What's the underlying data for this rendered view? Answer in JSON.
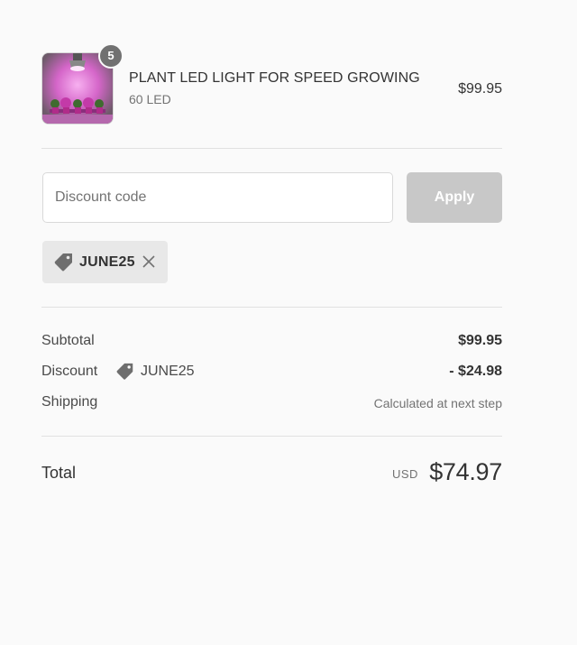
{
  "product": {
    "name": "PLANT LED LIGHT FOR SPEED GROWING",
    "variant": "60 LED",
    "price": "$99.95",
    "quantity": "5"
  },
  "discount_form": {
    "placeholder": "Discount code",
    "apply_label": "Apply"
  },
  "applied_discount": {
    "code": "JUNE25"
  },
  "summary": {
    "subtotal_label": "Subtotal",
    "subtotal_value": "$99.95",
    "discount_label": "Discount",
    "discount_code": "JUNE25",
    "discount_value": "- $24.98",
    "shipping_label": "Shipping",
    "shipping_value": "Calculated at next step"
  },
  "total": {
    "label": "Total",
    "currency": "USD",
    "amount": "$74.97"
  },
  "colors": {
    "background": "#fafafa",
    "apply_button_disabled": "#c8c8c8",
    "tag_chip": "#e8e8e8",
    "badge": "#717171"
  }
}
